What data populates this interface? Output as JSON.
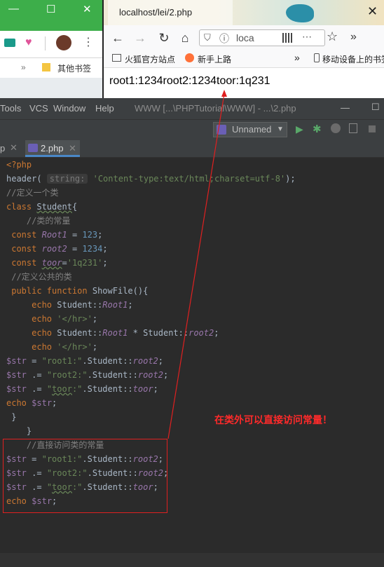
{
  "background_window": {
    "bookmark_label": "其他书签"
  },
  "firefox": {
    "tab_title": "localhost/lei/2.php",
    "url_partial": "loca",
    "bookmarks": [
      "火狐官方站点",
      "新手上路",
      "移动设备上的书签"
    ],
    "page_output": "root1:1234root2:1234toor:1q231"
  },
  "ide": {
    "menu": [
      "Tools",
      "VCS",
      "Window",
      "Help"
    ],
    "title": "WWW [...\\PHPTutorial\\WWW] - ...\\2.php",
    "run_config": "Unnamed",
    "tab_prev_suffix": "p",
    "tab_active": "2.php",
    "param_hint": "string:"
  },
  "annotation": "在类外可以直接访问常量！",
  "colors": {
    "annotation": "#ff2a2a",
    "editor_bg": "#2b2b2b",
    "keyword": "#cc7832",
    "string": "#6a8759"
  }
}
